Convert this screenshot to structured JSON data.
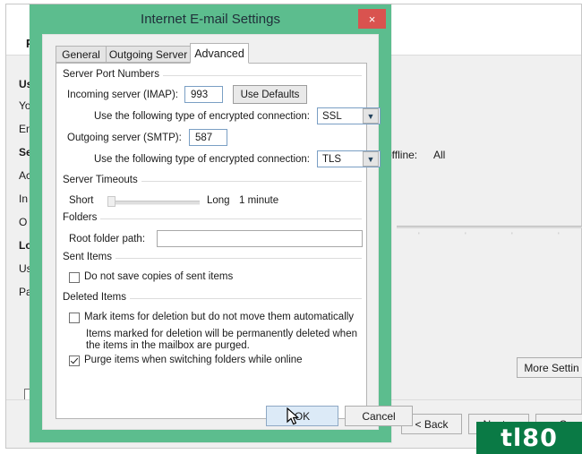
{
  "background_window": {
    "header_title": "P",
    "offline_label": "offline:",
    "offline_value": "All",
    "labels": [
      "Us",
      "Yo",
      "En",
      "Se",
      "Ac",
      "In",
      "O",
      "Lo",
      "Us",
      "Pa"
    ],
    "more_settings_label": "More Settin",
    "back_label": "< Back",
    "next_label": "Next >",
    "cancel_label": "Ca"
  },
  "dialog": {
    "title": "Internet E-mail Settings",
    "close_icon": "close-icon",
    "close_glyph": "×",
    "tabs": [
      {
        "label": "General",
        "active": false
      },
      {
        "label": "Outgoing Server",
        "active": false
      },
      {
        "label": "Advanced",
        "active": true
      }
    ],
    "groups": {
      "server_port_numbers": {
        "title": "Server Port Numbers",
        "incoming_label": "Incoming server (IMAP):",
        "incoming_value": "993",
        "use_defaults_label": "Use Defaults",
        "incoming_encryption_label": "Use the following type of encrypted connection:",
        "incoming_encryption_value": "SSL",
        "outgoing_label": "Outgoing server (SMTP):",
        "outgoing_value": "587",
        "outgoing_encryption_label": "Use the following type of encrypted connection:",
        "outgoing_encryption_value": "TLS",
        "dropdown_icon": "chevron-down-icon",
        "dropdown_glyph": "▼"
      },
      "server_timeouts": {
        "title": "Server Timeouts",
        "short_label": "Short",
        "long_label": "Long",
        "value_label": "1 minute"
      },
      "folders": {
        "title": "Folders",
        "root_folder_label": "Root folder path:",
        "root_folder_value": ""
      },
      "sent_items": {
        "title": "Sent Items",
        "do_not_save_label": "Do not save copies of sent items",
        "do_not_save_checked": false
      },
      "deleted_items": {
        "title": "Deleted Items",
        "mark_items_label": "Mark items for deletion but do not move them automatically",
        "mark_items_checked": false,
        "help_line1": "Items marked for deletion will be permanently deleted when",
        "help_line2": "the items in the mailbox are purged.",
        "purge_items_label": "Purge items when switching folders while online",
        "purge_items_checked": true
      }
    },
    "ok_label": "OK",
    "cancel_label": "Cancel"
  },
  "watermark": {
    "text": "tl80"
  },
  "colors": {
    "dialog_frame": "#5cbd8e",
    "close_button": "#d9534f",
    "focus_button": "#dceaf7",
    "watermark_bg": "#0a7a45"
  }
}
